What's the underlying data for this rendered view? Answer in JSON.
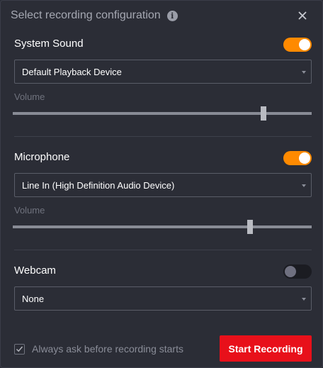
{
  "header": {
    "title": "Select recording configuration",
    "info_icon": "info-icon",
    "info_glyph": "i",
    "close_icon": "close-icon"
  },
  "system_sound": {
    "label": "System Sound",
    "enabled": true,
    "device": "Default Playback Device",
    "volume_label": "Volume",
    "volume": 0.84
  },
  "microphone": {
    "label": "Microphone",
    "enabled": true,
    "device": "Line In (High Definition Audio Device)",
    "volume_label": "Volume",
    "volume": 0.795
  },
  "webcam": {
    "label": "Webcam",
    "enabled": false,
    "device": "None"
  },
  "footer": {
    "ask_label": "Always ask before recording starts",
    "ask_checked": true,
    "start_label": "Start Recording"
  },
  "colors": {
    "accent": "#ff8a00",
    "start_button": "#e8101a",
    "background": "#2b2d36"
  }
}
